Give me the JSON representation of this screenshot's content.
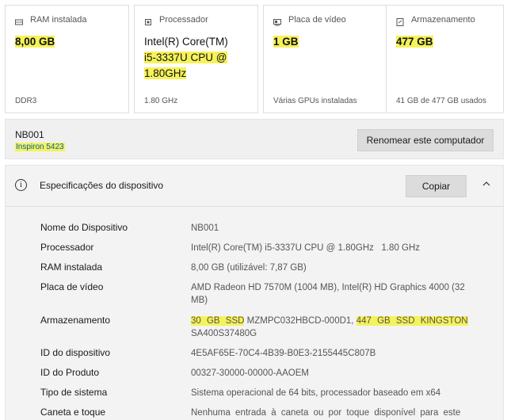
{
  "cards": [
    {
      "label": "RAM instalada",
      "value": "8,00 GB",
      "footer": "DDR3",
      "icon": "ram-icon"
    },
    {
      "label": "Processador",
      "value_line1": "Intel(R) Core(TM)",
      "value_line2": "i5-3337U CPU @",
      "value_line3": "1.80GHz",
      "footer": "1.80 GHz",
      "icon": "processor-icon"
    },
    {
      "label": "Placa de vídeo",
      "value": "1 GB",
      "footer": "Várias GPUs instaladas",
      "icon": "gpu-icon"
    },
    {
      "label": "Armazenamento",
      "value": "477 GB",
      "footer": "41 GB de 477 GB usados",
      "icon": "storage-icon"
    }
  ],
  "device": {
    "name": "NB001",
    "model": "Inspiron 5423",
    "rename_label": "Renomear este computador"
  },
  "specs": {
    "title": "Especificações do dispositivo",
    "copy_label": "Copiar",
    "rows": [
      {
        "key": "Nome do Dispositivo",
        "value": "NB001"
      },
      {
        "key": "Processador",
        "value": "Intel(R) Core(TM) i5-3337U CPU @ 1.80GHz   1.80 GHz"
      },
      {
        "key": "RAM instalada",
        "value": "8,00 GB (utilizável: 7,87 GB)"
      },
      {
        "key": "Placa de vídeo",
        "value_line1": "AMD Radeon HD 7570M (1004 MB), Intel(R) HD Graphics 4000 (32",
        "value_line2": "MB)"
      },
      {
        "key": "Armazenamento",
        "value_hl1": "30 GB SSD",
        "value_mid": " MZMPC032HBCD-000D1, ",
        "value_hl2": "447 GB SSD KINGSTON",
        "value_line2": "SA400S37480G"
      },
      {
        "key": "ID do dispositivo",
        "value": "4E5AF65E-70C4-4B39-B0E3-2155445C807B"
      },
      {
        "key": "ID do Produto",
        "value": "00327-30000-00000-AAOEM"
      },
      {
        "key": "Tipo de sistema",
        "value": "Sistema operacional de 64 bits, processador baseado em x64"
      },
      {
        "key": "Caneta e toque",
        "value": "Nenhuma entrada à caneta ou por toque disponível para este"
      }
    ]
  },
  "colors": {
    "highlight": "#f5f25a",
    "link": "#005fb8",
    "panel": "#f3f3f3"
  }
}
